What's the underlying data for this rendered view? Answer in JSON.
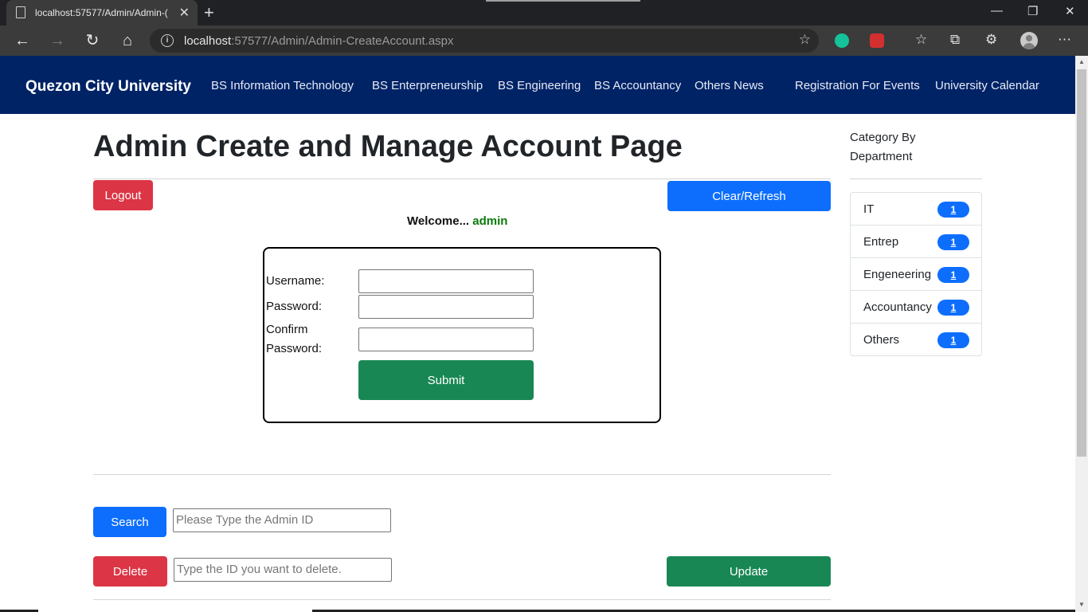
{
  "browser": {
    "tab_title": "localhost:57577/Admin/Admin-(",
    "url_host": "localhost",
    "url_rest": ":57577/Admin/Admin-CreateAccount.aspx"
  },
  "navbar": {
    "brand": "Quezon City University",
    "links": [
      "BS Information Technology",
      "BS Enterpreneurship",
      "BS Engineering",
      "BS Accountancy",
      "Others News",
      "Registration For Events",
      "University Calendar"
    ]
  },
  "main": {
    "title": "Admin Create and Manage Account Page",
    "logout_label": "Logout",
    "clear_label": "Clear/Refresh",
    "welcome_text": "Welcome...",
    "welcome_user": "admin",
    "form": {
      "username_label": "Username:",
      "password_label": "Password:",
      "confirm_label_1": "Confirm",
      "confirm_label_2": "Password:",
      "submit_label": "Submit"
    },
    "search_label": "Search",
    "search_placeholder": "Please Type the Admin ID",
    "delete_label": "Delete",
    "delete_placeholder": "Type the ID you want to delete.",
    "update_label": "Update"
  },
  "sidebar": {
    "heading": "Category By Department",
    "items": [
      {
        "label": "IT",
        "count": "1"
      },
      {
        "label": "Entrep",
        "count": "1"
      },
      {
        "label": "Engeneering",
        "count": "1"
      },
      {
        "label": "Accountancy",
        "count": "1"
      },
      {
        "label": "Others",
        "count": "1"
      }
    ]
  },
  "colors": {
    "navbar": "#002366",
    "danger": "#dc3545",
    "primary": "#0d6efd",
    "success": "#198754"
  }
}
